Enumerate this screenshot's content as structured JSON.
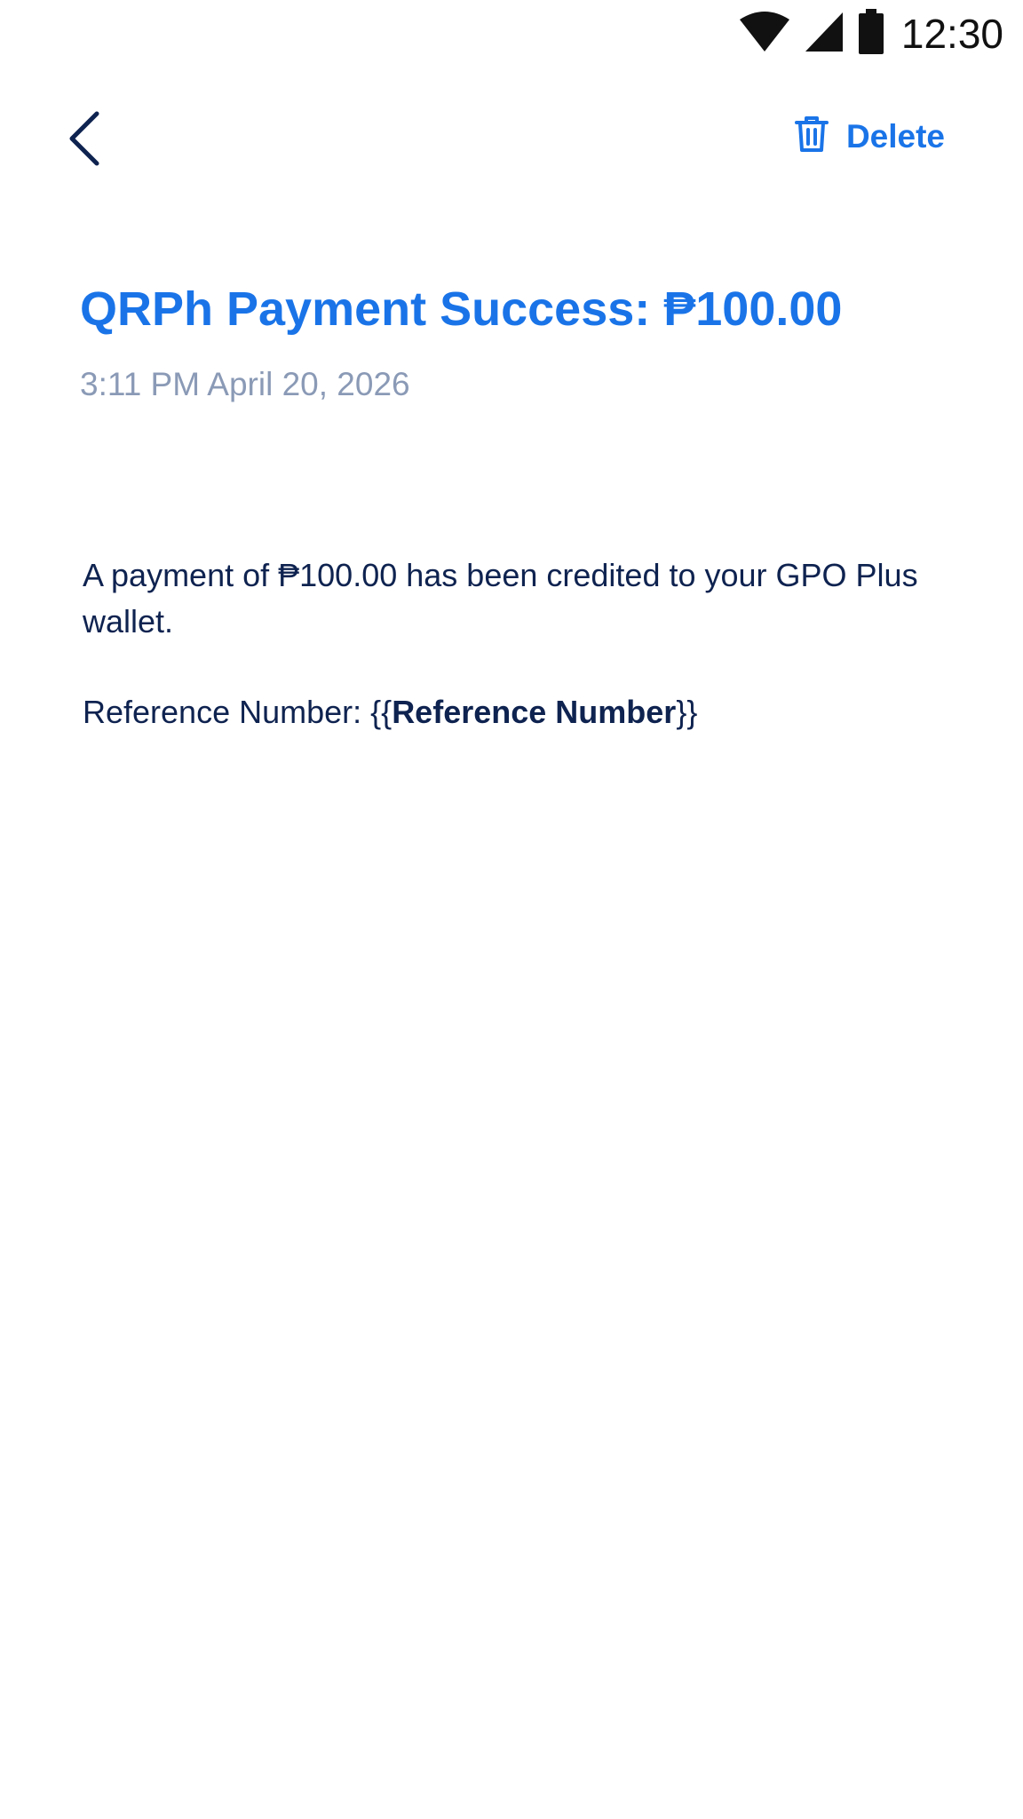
{
  "status_bar": {
    "time": "12:30",
    "icons": [
      "wifi-icon",
      "cellular-signal-icon",
      "battery-icon"
    ]
  },
  "header": {
    "back_icon": "chevron-left-icon",
    "delete_icon": "trash-icon",
    "delete_label": "Delete"
  },
  "notification": {
    "title": "QRPh Payment Success: ₱100.00",
    "timestamp": "3:11 PM April 20, 2026",
    "body": "A payment of ₱100.00 has been credited to your GPO Plus wallet.",
    "reference_label": "Reference Number: ",
    "reference_open": "{{",
    "reference_value": "Reference Number",
    "reference_close": "}}"
  },
  "colors": {
    "accent": "#1a74e8",
    "text_dark": "#0f2350",
    "text_muted": "#8a9ab6",
    "background": "#ffffff"
  }
}
